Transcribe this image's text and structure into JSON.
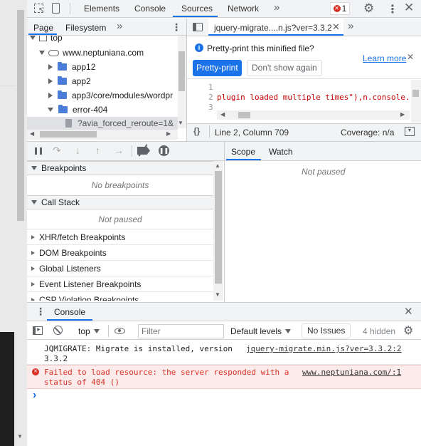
{
  "toolbar": {
    "tabs": [
      "Elements",
      "Console",
      "Sources",
      "Network"
    ],
    "active_tab": "Sources",
    "error_count": "1",
    "more": "»"
  },
  "navigator": {
    "tabs": [
      "Page",
      "Filesystem"
    ],
    "more": "»",
    "tree": [
      {
        "label": "top",
        "type": "frame",
        "depth": 0
      },
      {
        "label": "www.neptuniana.com",
        "type": "cloud",
        "depth": 1
      },
      {
        "label": "app12",
        "type": "folder",
        "depth": 2
      },
      {
        "label": "app2",
        "type": "folder",
        "depth": 2
      },
      {
        "label": "app3/core/modules/wordpr",
        "type": "folder",
        "depth": 2
      },
      {
        "label": "error-404",
        "type": "folder-open",
        "depth": 2
      },
      {
        "label": "?avia_forced_reroute=1&",
        "type": "file",
        "depth": 3
      }
    ]
  },
  "editor": {
    "tab_label": "jquery-migrate....n.js?ver=3.3.2",
    "infobar_text": "Pretty-print this minified file?",
    "learn_more": "Learn more",
    "pretty_print": "Pretty-print",
    "dont_show": "Don't show again",
    "line_numbers": [
      "1",
      "2",
      "3"
    ],
    "code_line": "plugin loaded multiple times\"),n.console.i",
    "status_position": "Line 2, Column 709",
    "coverage": "Coverage: n/a",
    "braces": "{}"
  },
  "debugger": {
    "sections": [
      {
        "title": "Breakpoints",
        "expanded": true,
        "empty": "No breakpoints"
      },
      {
        "title": "Call Stack",
        "expanded": true,
        "empty": "Not paused"
      }
    ],
    "collapsed": [
      "XHR/fetch Breakpoints",
      "DOM Breakpoints",
      "Global Listeners",
      "Event Listener Breakpoints",
      "CSP Violation Breakpoints"
    ]
  },
  "scope": {
    "tabs": [
      "Scope",
      "Watch"
    ],
    "active": "Scope",
    "empty": "Not paused"
  },
  "drawer": {
    "title": "Console",
    "context": "top",
    "filter_placeholder": "Filter",
    "levels": "Default levels",
    "issues": "No Issues",
    "hidden": "4 hidden",
    "messages": [
      {
        "level": "info",
        "text": "JQMIGRATE: Migrate is installed, version 3.3.2",
        "source": "jquery-migrate.min.js?ver=3.3.2:2"
      },
      {
        "level": "error",
        "text": "Failed to load resource: the server responded with a status of 404 ()",
        "source": "www.neptuniana.com/:1"
      }
    ],
    "prompt": "›"
  },
  "colors": {
    "accent": "#1a73e8",
    "error": "#d93025",
    "error_bg": "#fcebeb",
    "toolbar_bg": "#f1f3f4"
  }
}
